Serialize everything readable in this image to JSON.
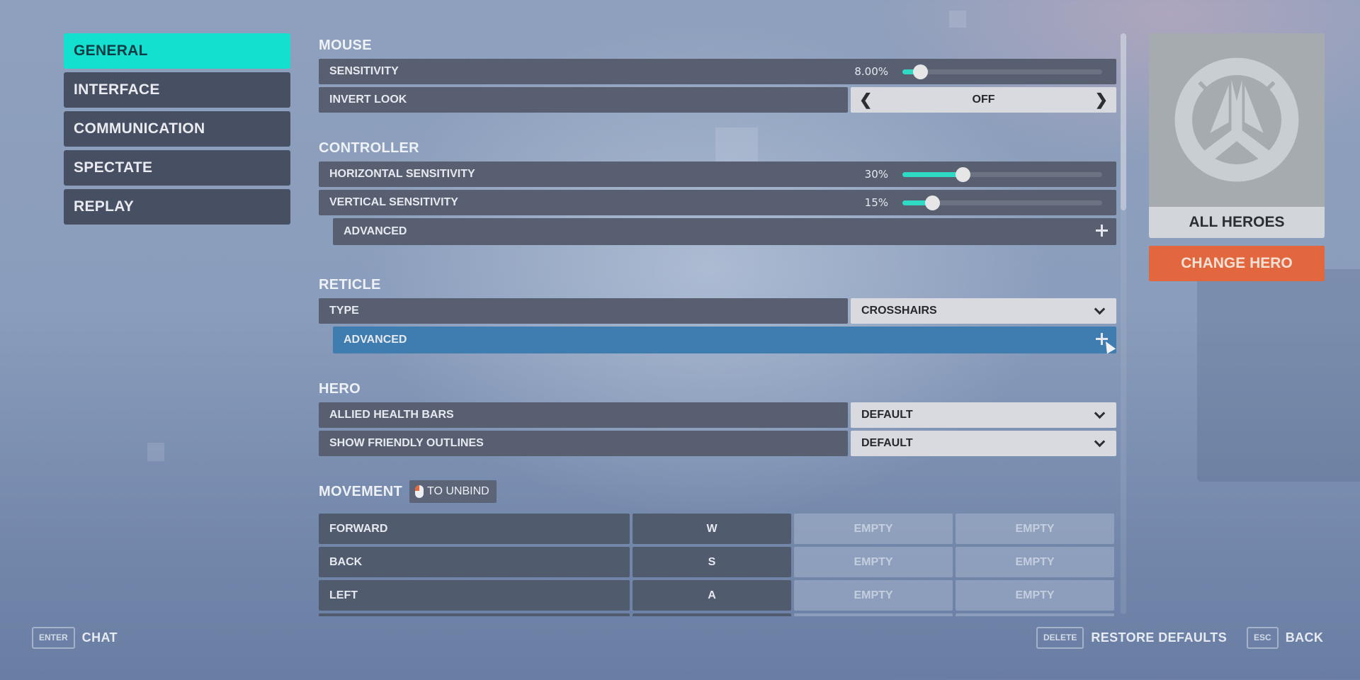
{
  "sidebar": {
    "items": [
      {
        "label": "GENERAL",
        "active": true
      },
      {
        "label": "INTERFACE",
        "active": false
      },
      {
        "label": "COMMUNICATION",
        "active": false
      },
      {
        "label": "SPECTATE",
        "active": false
      },
      {
        "label": "REPLAY",
        "active": false
      }
    ]
  },
  "mouse": {
    "title": "MOUSE",
    "sensitivity": {
      "label": "SENSITIVITY",
      "value_text": "8.00%",
      "fill_fraction": 0.09
    },
    "invert_look": {
      "label": "INVERT LOOK",
      "value": "OFF",
      "prev_icon": "chevron-left-icon",
      "next_icon": "chevron-right-icon"
    }
  },
  "controller": {
    "title": "CONTROLLER",
    "horizontal": {
      "label": "HORIZONTAL SENSITIVITY",
      "value_text": "30%",
      "fill_fraction": 0.3
    },
    "vertical": {
      "label": "VERTICAL SENSITIVITY",
      "value_text": "15%",
      "fill_fraction": 0.15
    },
    "advanced": {
      "label": "ADVANCED",
      "icon": "plus-icon"
    }
  },
  "reticle": {
    "title": "RETICLE",
    "type": {
      "label": "TYPE",
      "value": "CROSSHAIRS",
      "icon": "chevron-down-icon"
    },
    "advanced": {
      "label": "ADVANCED",
      "icon": "plus-icon",
      "hovered": true
    }
  },
  "hero": {
    "title": "HERO",
    "allied_health_bars": {
      "label": "ALLIED HEALTH BARS",
      "value": "DEFAULT"
    },
    "show_friendly_outlines": {
      "label": "SHOW FRIENDLY OUTLINES",
      "value": "DEFAULT"
    }
  },
  "movement": {
    "title": "MOVEMENT",
    "unbind_hint": "TO UNBIND",
    "unbind_icon": "mouse-icon",
    "bindings": [
      {
        "action": "FORWARD",
        "key": "W",
        "alt1": "EMPTY",
        "alt2": "EMPTY"
      },
      {
        "action": "BACK",
        "key": "S",
        "alt1": "EMPTY",
        "alt2": "EMPTY"
      },
      {
        "action": "LEFT",
        "key": "A",
        "alt1": "EMPTY",
        "alt2": "EMPTY"
      },
      {
        "action": "",
        "key": "",
        "alt1": "",
        "alt2": ""
      }
    ]
  },
  "hero_panel": {
    "name": "ALL HEROES",
    "logo_icon": "overwatch-logo-icon",
    "change_button": "CHANGE HERO"
  },
  "footer": {
    "chat": {
      "key": "ENTER",
      "label": "CHAT"
    },
    "restore": {
      "key": "DELETE",
      "label": "RESTORE DEFAULTS"
    },
    "back": {
      "key": "ESC",
      "label": "BACK"
    }
  },
  "colors": {
    "accent": "#13e0cf",
    "slider_fill": "#2fd9c4",
    "hover_row": "#3f7db0",
    "change_hero": "#e2673f",
    "row_bg": "#575f70"
  }
}
